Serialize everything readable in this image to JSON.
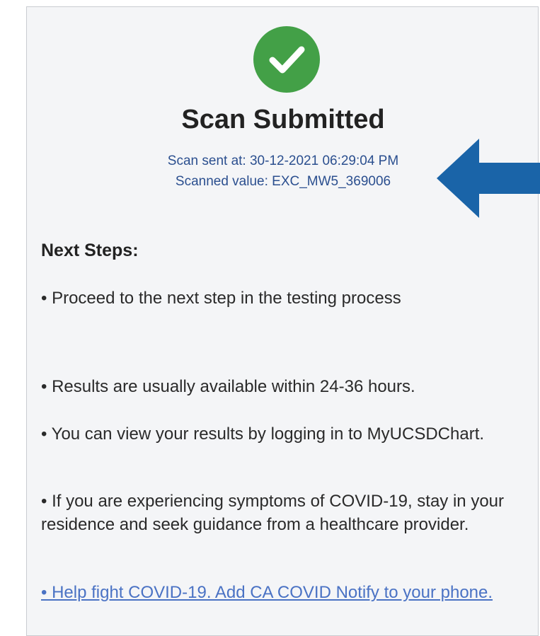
{
  "screen": {
    "title": "Scan Submitted",
    "scan_sent": "Scan sent at: 30-12-2021 06:29:04 PM",
    "scanned_value": "Scanned value: EXC_MW5_369006"
  },
  "next_steps": {
    "heading": "Next Steps:",
    "items": [
      "• Proceed to the next step in the testing process",
      "• Results are usually available within 24-36 hours.",
      "• You can view your results by logging in to MyUCSDChart.",
      "• If you are experiencing symptoms of COVID-19, stay in your residence and seek guidance from a healthcare provider."
    ],
    "link": "• Help fight COVID-19. Add CA COVID Notify to your phone."
  },
  "icons": {
    "status": "check-circle-icon",
    "callout": "arrow-left-icon"
  },
  "colors": {
    "success_green": "#43a047",
    "meta_text": "#2b4f8f",
    "link_text": "#4a72c4",
    "arrow_blue": "#1a64a8",
    "background": "#f4f5f7"
  }
}
